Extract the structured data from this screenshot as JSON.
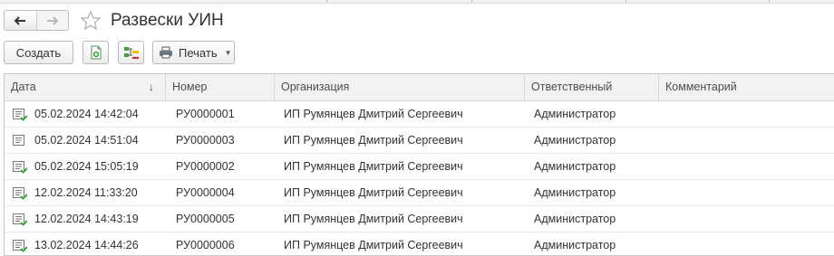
{
  "window": {
    "title": "Развески УИН"
  },
  "nav": {
    "back_icon": "arrow-left-icon",
    "forward_icon": "arrow-right-icon",
    "favorite_icon": "star-outline-icon"
  },
  "toolbar": {
    "create_label": "Создать",
    "copy_icon": "copy-document-icon",
    "structure_icon": "document-structure-icon",
    "print_label": "Печать",
    "print_icon": "printer-icon"
  },
  "table": {
    "columns": [
      "Дата",
      "Номер",
      "Организация",
      "Ответственный",
      "Комментарий"
    ],
    "sorted_column": "Дата",
    "rows": [
      {
        "date": "05.02.2024 14:42:04",
        "number": "РУ0000001",
        "organization": "ИП Румянцев Дмитрий Сергеевич",
        "responsible": "Администратор",
        "comment": "",
        "status": "posted"
      },
      {
        "date": "05.02.2024 14:51:04",
        "number": "РУ0000003",
        "organization": "ИП Румянцев Дмитрий Сергеевич",
        "responsible": "Администратор",
        "comment": "",
        "status": "draft"
      },
      {
        "date": "05.02.2024 15:05:19",
        "number": "РУ0000002",
        "organization": "ИП Румянцев Дмитрий Сергеевич",
        "responsible": "Администратор",
        "comment": "",
        "status": "posted"
      },
      {
        "date": "12.02.2024 11:33:20",
        "number": "РУ0000004",
        "organization": "ИП Румянцев Дмитрий Сергеевич",
        "responsible": "Администратор",
        "comment": "",
        "status": "posted"
      },
      {
        "date": "12.02.2024 14:43:19",
        "number": "РУ0000005",
        "organization": "ИП Румянцев Дмитрий Сергеевич",
        "responsible": "Администратор",
        "comment": "",
        "status": "posted"
      },
      {
        "date": "13.02.2024 14:44:26",
        "number": "РУ0000006",
        "organization": "ИП Румянцев Дмитрий Сергеевич",
        "responsible": "Администратор",
        "comment": "",
        "status": "posted"
      }
    ]
  },
  "colors": {
    "posted_mark": "#3aa53a",
    "header_bg": "#f2f2f2",
    "accent_yellow": "#e8c000"
  }
}
